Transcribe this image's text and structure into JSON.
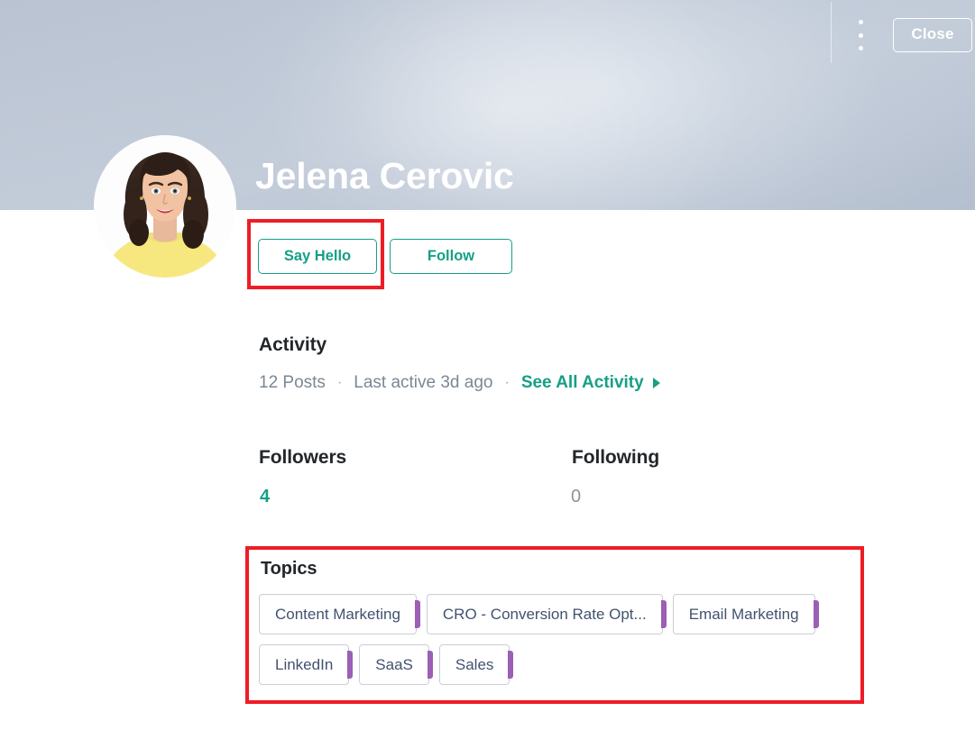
{
  "banner": {
    "close_label": "Close",
    "kebab_icon": "more-vertical-icon",
    "accent_white": "#ffffff",
    "gradient_from": "#b9c3d1",
    "gradient_to": "#b4bfcf"
  },
  "profile": {
    "name": "Jelena Cerovic",
    "avatar_icon": "user-avatar-photo",
    "actions": [
      {
        "id": "say-hello",
        "label": "Say Hello"
      },
      {
        "id": "follow",
        "label": "Follow"
      }
    ],
    "accent_teal": "#16a085"
  },
  "activity": {
    "heading": "Activity",
    "posts": "12 Posts",
    "separator": "·",
    "last_active": "Last active 3d ago",
    "see_all_label": "See All Activity",
    "see_all_caret_icon": "caret-right-icon"
  },
  "stats": {
    "followers_label": "Followers",
    "followers_value": "4",
    "following_label": "Following",
    "following_value": "0"
  },
  "topics": {
    "heading": "Topics",
    "accent_purple": "#9b5fb5",
    "items": [
      "Content Marketing",
      "CRO - Conversion Rate Opt...",
      "Email Marketing",
      "LinkedIn",
      "SaaS",
      "Sales"
    ]
  },
  "annotations": {
    "color": "#ee1c25",
    "boxes": [
      "say-hello-button",
      "topics-section"
    ]
  }
}
